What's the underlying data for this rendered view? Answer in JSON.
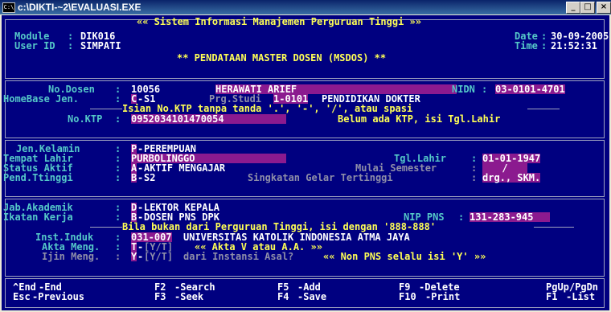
{
  "window": {
    "title": "c:\\DIKTI-~2\\EVALUASI.EXE",
    "icon_text": "C:\\",
    "btn_minimize": "_",
    "btn_maximize": "□",
    "btn_close": "×"
  },
  "header": {
    "system_title": "«« Sistem Informasi Manajemen Perguruan Tinggi »»",
    "module_label": "Module",
    "module_value": "DIK016",
    "userid_label": "User ID",
    "userid_value": "SIMPATI",
    "date_label": "Date",
    "date_value": "30-09-2005",
    "time_label": "Time",
    "time_value": "21:52:31",
    "screen_title": "** PENDATAAN MASTER DOSEN (MSDOS) **"
  },
  "section1": {
    "no_dosen_label": "No.Dosen",
    "no_dosen_value": "10056",
    "nama_value": "HERAWATI ARIEF",
    "nidn_label": "NIDN",
    "nidn_value": "03-0101-4701",
    "homebase_label": "HomeBase Jen.",
    "homebase_code": "C",
    "homebase_value": "S1",
    "prgstudi_label": "Prg.Studi",
    "prgstudi_code": "1-0101",
    "prgstudi_value": "PENDIDIKAN DOKTER",
    "ktp_hint": "Isian No.KTP tanpa tanda '.', '-', '/', atau spasi",
    "ktp_label": "No.KTP",
    "ktp_value": "0952034101470054",
    "ktp_note": "Belum ada KTP, isi Tgl.Lahir"
  },
  "section2": {
    "jk_label": "Jen.Kelamin",
    "jk_code": "P",
    "jk_value": "PEREMPUAN",
    "tempat_label": "Tempat Lahir",
    "tempat_value": "PURBOLINGGO",
    "tgl_label": "Tgl.Lahir",
    "tgl_value": "01-01-1947",
    "status_label": "Status Aktif",
    "status_code": "A",
    "status_value": "AKTIF MENGAJAR",
    "semester_label": "Mulai Semester",
    "semester_value": "/",
    "pend_label": "Pend.Ttinggi",
    "pend_code": "B",
    "pend_value": "S2",
    "gelar_label": "Singkatan Gelar Tertinggi",
    "gelar_value": "drg., SKM."
  },
  "section3": {
    "jab_label": "Jab.Akademik",
    "jab_code": "D",
    "jab_value": "LEKTOR KEPALA",
    "ikatan_label": "Ikatan Kerja",
    "ikatan_code": "B",
    "ikatan_value": "DOSEN PNS DPK",
    "nip_label": "NIP PNS",
    "nip_value": "131-283-945",
    "pt_hint": "Bila bukan dari Perguruan Tinggi, isi dengan '888-888'",
    "inst_label": "Inst.Induk",
    "inst_code": "031-007",
    "inst_value": "UNIVERSITAS KATOLIK INDONESIA ATMA JAYA",
    "akta_label": "Akta Meng.",
    "akta_code": "T",
    "akta_opts": "[Y/T]",
    "akta_hint": "«« Akta V atau A.A. »»",
    "ijin_label": "Ijin Meng.",
    "ijin_code": "Y",
    "ijin_opts": "[Y/T]",
    "ijin_text": "dari Instansi Asal?",
    "ijin_hint": "«« Non PNS selalu isi 'Y' »»"
  },
  "footer": {
    "end_key": "^End",
    "end_action": "-End",
    "esc_key": "Esc",
    "esc_action": "-Previous",
    "f2_key": "F2",
    "f2_action": "-Search",
    "f3_key": "F3",
    "f3_action": "-Seek",
    "f5_key": "F5",
    "f5_action": "-Add",
    "f4_key": "F4",
    "f4_action": "-Save",
    "f9_key": "F9",
    "f9_action": "-Delete",
    "f10_key": "F10",
    "f10_action": "-Print",
    "pg_key": "PgUp/PgDn",
    "f1_key": "F1",
    "f1_action": "-List"
  }
}
